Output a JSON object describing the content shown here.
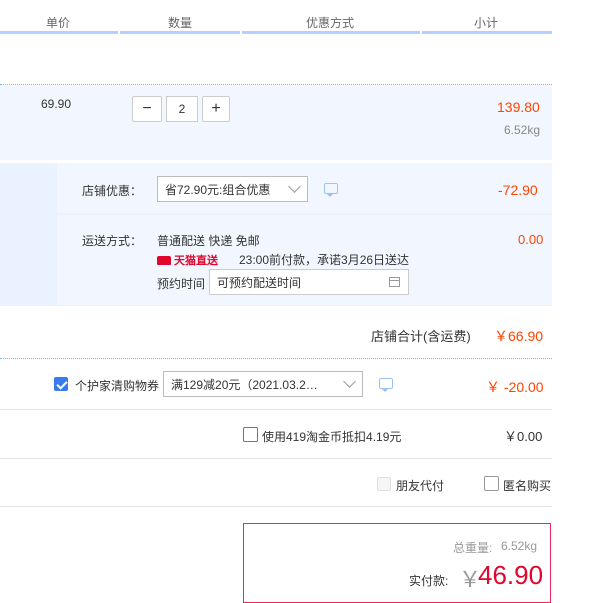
{
  "header": {
    "col_price": "单价",
    "col_qty": "数量",
    "col_discount": "优惠方式",
    "col_subtotal": "小计"
  },
  "item": {
    "unit_price": "69.90",
    "qty_minus": "−",
    "qty_value": "2",
    "qty_plus": "+",
    "subtotal": "139.80",
    "weight": "6.52kg"
  },
  "shop": {
    "discount_label": "店铺优惠：",
    "discount_select": "省72.90元:组合优惠",
    "discount_amount": "-72.90",
    "shipping_label": "运送方式：",
    "shipping_method": "普通配送 快递 免邮",
    "tmall_badge": "天猫直送",
    "promise_text": "23:00前付款，承诺3月26日送达",
    "reserve_label": "预约时间",
    "reserve_placeholder": "可预约配送时间",
    "shipping_fee": "0.00",
    "total_label": "店铺合计(含运费)",
    "total_value": "￥66.90"
  },
  "coupon": {
    "label": "个护家清购物券",
    "select": "满129减20元（2021.03.2…",
    "amount": "￥ -20.00",
    "checked": true
  },
  "taojinbi": {
    "label": "使用419淘金币抵扣4.19元",
    "amount": "￥0.00"
  },
  "options": {
    "friend_pay": "朋友代付",
    "anonymous": "匿名购买"
  },
  "summary": {
    "weight_label": "总重量:",
    "weight_value": "6.52kg",
    "pay_label": "实付款:",
    "currency": "￥",
    "pay_value": "46.90"
  },
  "colors": {
    "accent_blue": "#3b7bf0",
    "price_red": "#ff4400",
    "row_bg": "#f2f7ff",
    "summary_border": "#ee2a5c"
  }
}
